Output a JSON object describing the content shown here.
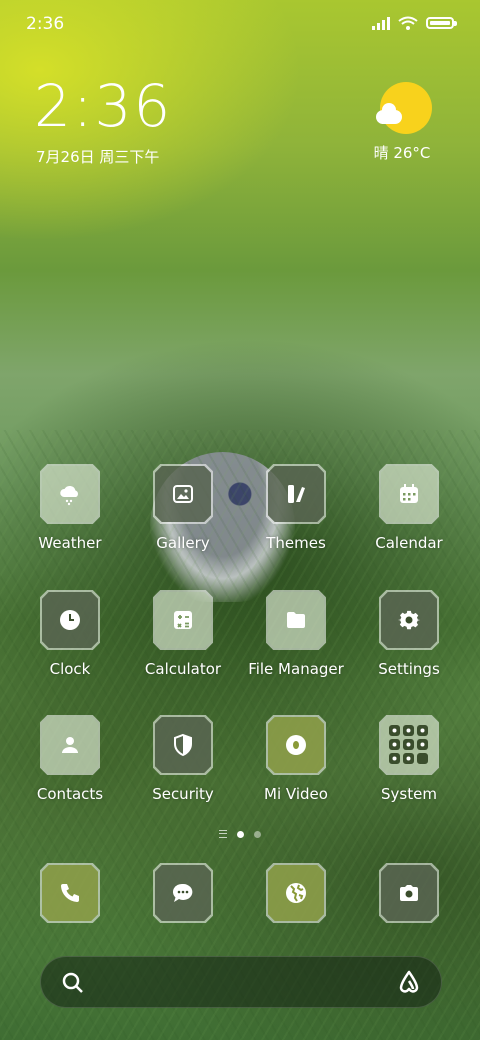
{
  "status_bar": {
    "time": "2:36"
  },
  "clock_widget": {
    "time": "2:36",
    "date": "7月26日 周三下午"
  },
  "weather_widget": {
    "text": "晴 26°C",
    "icon": "sun-cloud-icon",
    "sun_color": "#f8d21c"
  },
  "apps": [
    {
      "name": "weather",
      "label": "Weather",
      "icon": "cloud-rain-icon",
      "style": "glass"
    },
    {
      "name": "gallery",
      "label": "Gallery",
      "icon": "image-icon",
      "style": "dark"
    },
    {
      "name": "themes",
      "label": "Themes",
      "icon": "brush-icon",
      "style": "dark"
    },
    {
      "name": "calendar",
      "label": "Calendar",
      "icon": "calendar-icon",
      "style": "glass"
    },
    {
      "name": "clock",
      "label": "Clock",
      "icon": "clock-icon",
      "style": "dark"
    },
    {
      "name": "calculator",
      "label": "Calculator",
      "icon": "calculator-icon",
      "style": "glass"
    },
    {
      "name": "file-manager",
      "label": "File Manager",
      "icon": "folder-icon",
      "style": "glass"
    },
    {
      "name": "settings",
      "label": "Settings",
      "icon": "gear-icon",
      "style": "dark"
    },
    {
      "name": "contacts",
      "label": "Contacts",
      "icon": "person-icon",
      "style": "glass"
    },
    {
      "name": "security",
      "label": "Security",
      "icon": "shield-icon",
      "style": "dark"
    },
    {
      "name": "mi-video",
      "label": "Mi Video",
      "icon": "video-icon",
      "style": "olive"
    },
    {
      "name": "system",
      "label": "System",
      "icon": "folder-grid-icon",
      "style": "glass"
    }
  ],
  "dock": [
    {
      "name": "phone",
      "icon": "phone-icon",
      "style": "olive"
    },
    {
      "name": "messages",
      "icon": "chat-icon",
      "style": "dark"
    },
    {
      "name": "browser",
      "icon": "globe-icon",
      "style": "olive"
    },
    {
      "name": "camera",
      "icon": "camera-icon",
      "style": "dark"
    }
  ],
  "page_indicator": {
    "pages": 2,
    "active": 1
  },
  "search_bar": {
    "left_icon": "search-icon",
    "right_icon": "assistant-icon"
  }
}
